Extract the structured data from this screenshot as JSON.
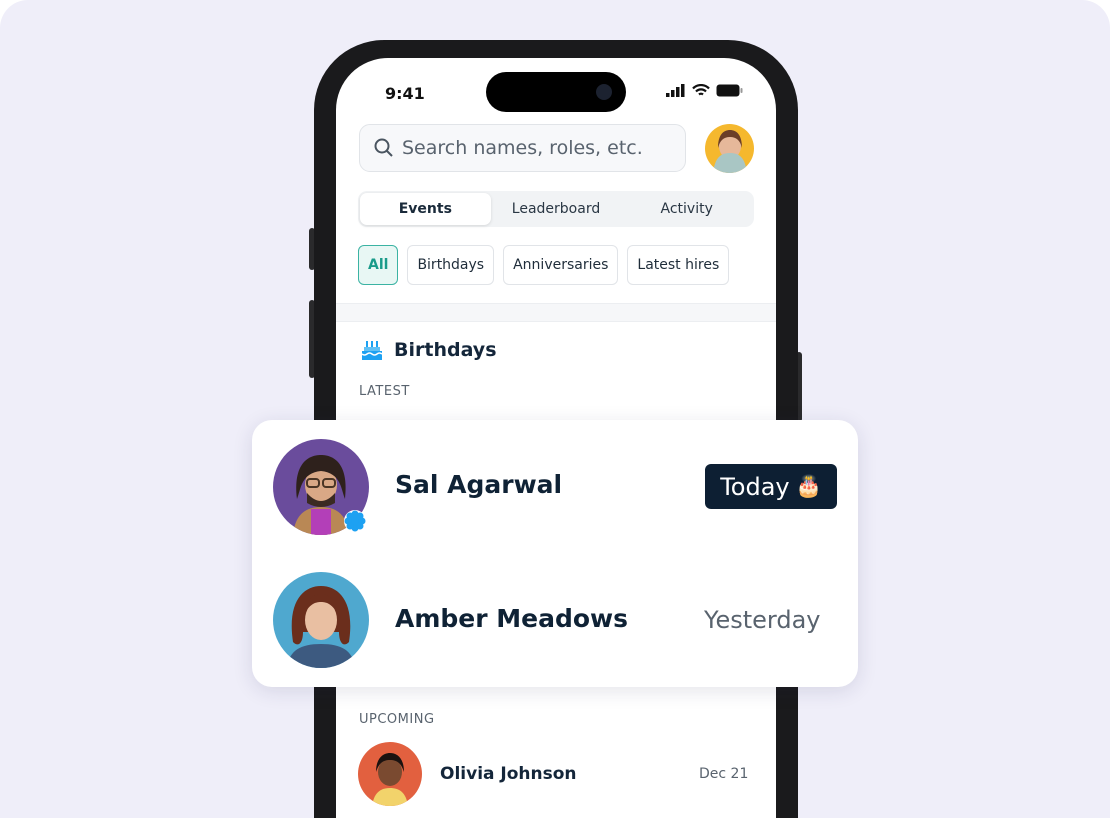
{
  "status_bar": {
    "time": "9:41"
  },
  "search": {
    "placeholder": "Search names, roles, etc."
  },
  "tabs": [
    {
      "label": "Events",
      "active": true
    },
    {
      "label": "Leaderboard"
    },
    {
      "label": "Activity"
    }
  ],
  "filters": [
    {
      "label": "All",
      "active": true
    },
    {
      "label": "Birthdays"
    },
    {
      "label": "Anniversaries"
    },
    {
      "label": "Latest hires"
    }
  ],
  "section": {
    "title": "Birthdays",
    "icon": "birthday-cake-icon",
    "latest_label": "LATEST",
    "upcoming_label": "UPCOMING"
  },
  "latest": [
    {
      "name": "Sal Agarwal",
      "when": "Today",
      "emoji": "🎂",
      "badge": "verified-badge-icon"
    },
    {
      "name": "Amber Meadows",
      "when": "Yesterday"
    }
  ],
  "upcoming": [
    {
      "name": "Olivia Johnson",
      "date": "Dec 21"
    }
  ],
  "colors": {
    "accent": "#1a9b8a",
    "pill": "#0d1f33",
    "badge": "#1da1f2"
  }
}
